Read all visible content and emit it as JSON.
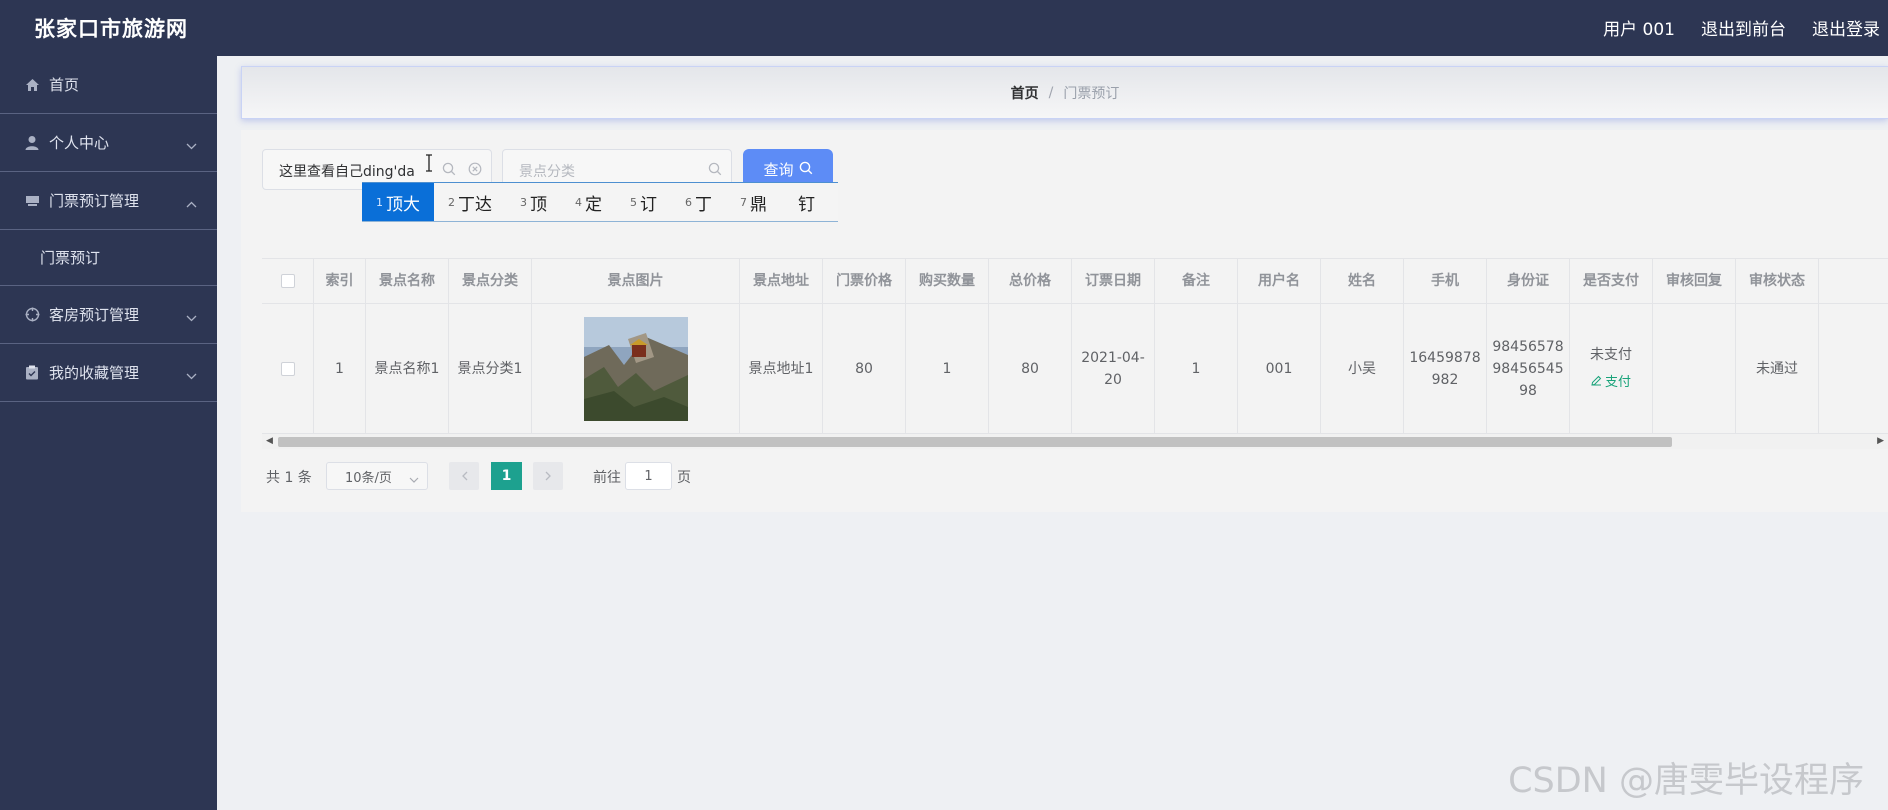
{
  "header": {
    "title": "张家口市旅游网",
    "links": [
      "用户 001",
      "退出到前台",
      "退出登录"
    ]
  },
  "sidebar": {
    "items": [
      {
        "label": "首页",
        "icon": "home-icon"
      },
      {
        "label": "个人中心",
        "icon": "user-icon",
        "expanded": false
      },
      {
        "label": "门票预订管理",
        "icon": "ticket-icon",
        "expanded": true,
        "children": [
          "门票预订"
        ]
      },
      {
        "label": "客房预订管理",
        "icon": "target-icon",
        "expanded": false
      },
      {
        "label": "我的收藏管理",
        "icon": "clipboard-icon",
        "expanded": false
      }
    ]
  },
  "breadcrumb": {
    "home": "首页",
    "sep": "/",
    "current": "门票预订"
  },
  "search": {
    "name_value": "这里查看自己ding'da",
    "category_placeholder": "景点分类",
    "query_label": "查询"
  },
  "ime": {
    "candidates": [
      {
        "n": "1",
        "text": "顶大",
        "selected": true
      },
      {
        "n": "2",
        "text": "丁达"
      },
      {
        "n": "3",
        "text": "顶"
      },
      {
        "n": "4",
        "text": "定"
      },
      {
        "n": "5",
        "text": "订"
      },
      {
        "n": "6",
        "text": "丁"
      },
      {
        "n": "7",
        "text": "鼎"
      },
      {
        "n": "",
        "text": "钉"
      }
    ]
  },
  "table": {
    "columns": [
      "",
      "索引",
      "景点名称",
      "景点分类",
      "景点图片",
      "景点地址",
      "门票价格",
      "购买数量",
      "总价格",
      "订票日期",
      "备注",
      "用户名",
      "姓名",
      "手机",
      "身份证",
      "是否支付",
      "审核回复",
      "审核状态",
      ""
    ],
    "rows": [
      {
        "index": "1",
        "name": "景点名称1",
        "category": "景点分类1",
        "address": "景点地址1",
        "price": "80",
        "qty": "1",
        "total": "80",
        "date": "2021-04-20",
        "note": "1",
        "username": "001",
        "realname": "小吴",
        "phone": "16459878982",
        "idcard": "984565789845654598",
        "paid": "未支付",
        "pay_action": "支付",
        "reply": "",
        "status": "未通过"
      }
    ]
  },
  "pagination": {
    "total": "共 1 条",
    "page_size": "10条/页",
    "current": "1",
    "goto_label": "前往",
    "goto_value": "1",
    "page_suffix": "页"
  },
  "watermark": "CSDN @唐雯毕设程序",
  "colors": {
    "sidebar": "#2d3653",
    "primary": "#5d8cf6",
    "pager_active": "#1da18f",
    "pay": "#19a37a"
  }
}
